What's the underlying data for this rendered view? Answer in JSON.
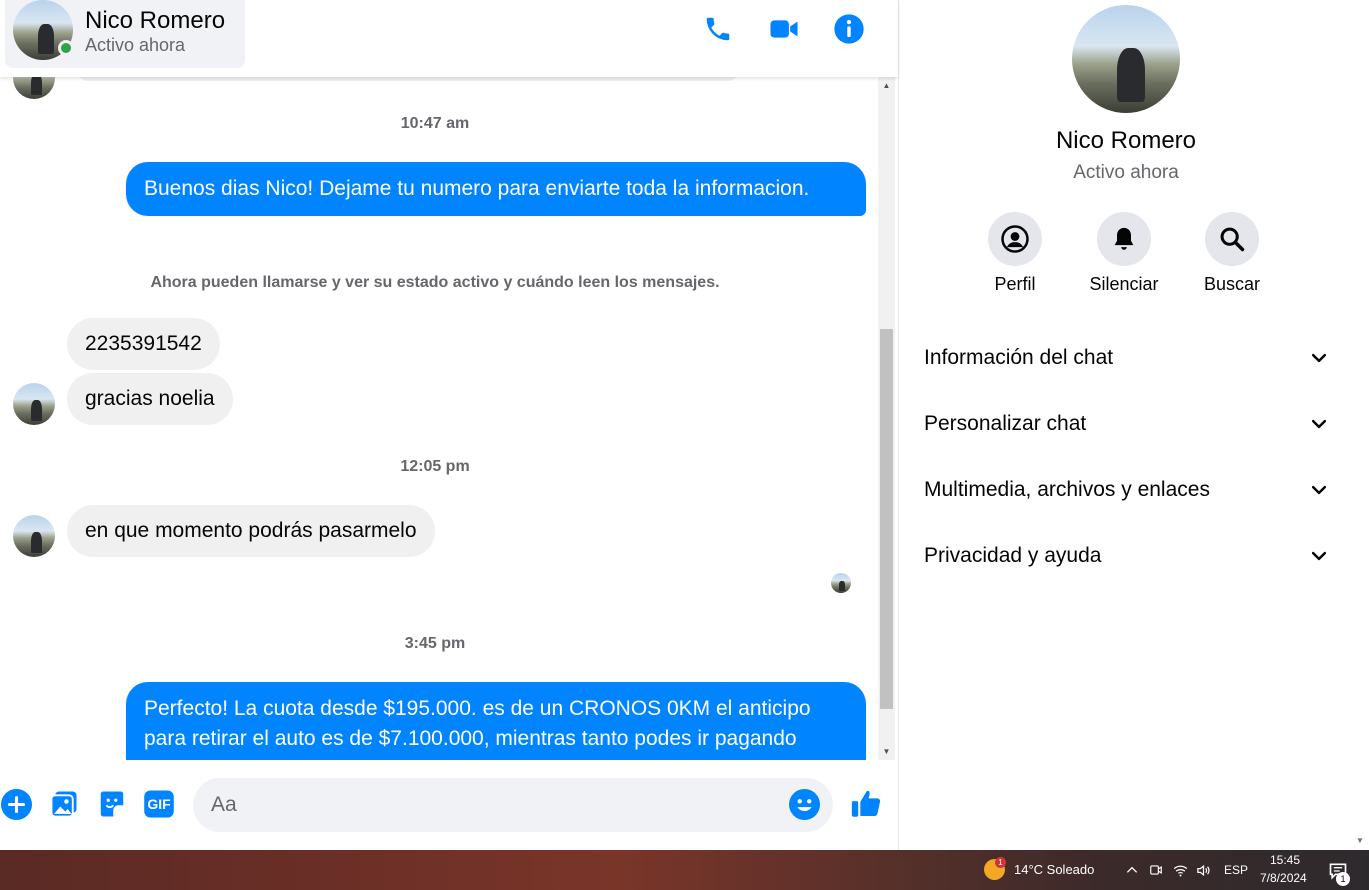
{
  "header": {
    "contact_name": "Nico Romero",
    "contact_status": "Activo ahora",
    "call_icon": "phone-icon",
    "video_icon": "video-camera-icon",
    "info_icon": "info-icon"
  },
  "messages": {
    "ts1": "10:47 am",
    "out1": "Buenos dias Nico! Dejame tu numero para enviarte toda la informacion.",
    "system_note": "Ahora pueden llamarse y ver su estado activo y cuándo leen los mensajes.",
    "in1": "2235391542",
    "in2": "gracias noelia",
    "ts2": "12:05 pm",
    "in3": "en que momento podrás pasarmelo",
    "ts3": "3:45 pm",
    "out2": "Perfecto! La cuota desde $195.000. es de un CRONOS 0KM el anticipo para retirar el auto es de $7.100.000, mientras tanto podes ir pagando"
  },
  "composer": {
    "placeholder": "Aa",
    "icons": [
      "plus-icon",
      "image-icon",
      "sticker-icon",
      "gif-icon",
      "emoji-icon",
      "thumbs-up-icon"
    ],
    "gif_label": "GIF"
  },
  "panel": {
    "name": "Nico Romero",
    "status": "Activo ahora",
    "actions": [
      {
        "label": "Perfil",
        "icon": "profile-icon"
      },
      {
        "label": "Silenciar",
        "icon": "bell-icon"
      },
      {
        "label": "Buscar",
        "icon": "search-icon"
      }
    ],
    "sections": [
      {
        "label": "Información del chat"
      },
      {
        "label": "Personalizar chat"
      },
      {
        "label": "Multimedia, archivos y enlaces"
      },
      {
        "label": "Privacidad y ayuda"
      }
    ]
  },
  "taskbar": {
    "weather_badge": "1",
    "weather": "14°C  Soleado",
    "language": "ESP",
    "time": "15:45",
    "date": "7/8/2024",
    "notification_count": "1"
  },
  "colors": {
    "accent": "#0084ff",
    "incoming_bubble": "#f0f0f0",
    "online": "#31a24c"
  }
}
